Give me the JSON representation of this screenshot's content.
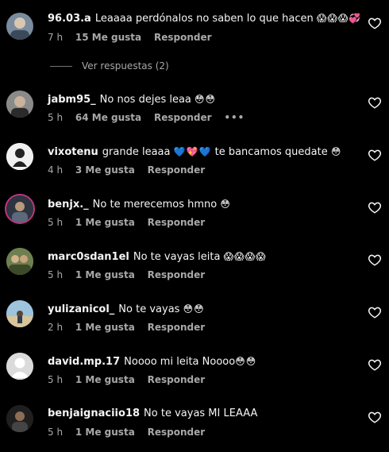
{
  "comments": [
    {
      "username": "96.03.a",
      "text": "Leaaaa perdónalos no saben lo que hacen",
      "emoji": "😱😱😱💞",
      "time": "7 h",
      "likes": "15 Me gusta",
      "reply": "Responder"
    },
    {
      "username": "jabm95_",
      "text": "No nos dejes leaa",
      "emoji": "😳😳",
      "time": "5 h",
      "likes": "64 Me gusta",
      "reply": "Responder",
      "more": "•••"
    },
    {
      "username": "vixotenu",
      "text": "grande leaaa",
      "emoji": "💙💖💙",
      "text2": "te bancamos quedate",
      "emoji2": "😳",
      "time": "4 h",
      "likes": "3 Me gusta",
      "reply": "Responder"
    },
    {
      "username": "benjx._",
      "text": "No te merecemos hmno",
      "emoji": "😳",
      "time": "5 h",
      "likes": "1 Me gusta",
      "reply": "Responder"
    },
    {
      "username": "marc0sdan1el",
      "text": "No te vayas leita",
      "emoji": "😱😱😱😱",
      "time": "5 h",
      "likes": "1 Me gusta",
      "reply": "Responder"
    },
    {
      "username": "yulizanicol_",
      "text": "No te vayas",
      "emoji": "😳😳",
      "time": "2 h",
      "likes": "1 Me gusta",
      "reply": "Responder"
    },
    {
      "username": "david.mp.17",
      "text": "Noooo mi leita Noooo",
      "emoji": "😳😳",
      "time": "5 h",
      "likes": "1 Me gusta",
      "reply": "Responder"
    },
    {
      "username": "benjaignaciio18",
      "text": "No te vayas MI LEAAA",
      "emoji": "",
      "time": "5 h",
      "likes": "1 Me gusta",
      "reply": "Responder"
    }
  ],
  "replies_toggle": "Ver respuestas (2)",
  "icons": {
    "like": "heart-outline-icon",
    "avatar": "avatar-icon"
  },
  "colors": {
    "background": "#000000",
    "text": "#f5f5f5",
    "secondary": "#a8a8a8",
    "story_ring": "#c13584"
  }
}
